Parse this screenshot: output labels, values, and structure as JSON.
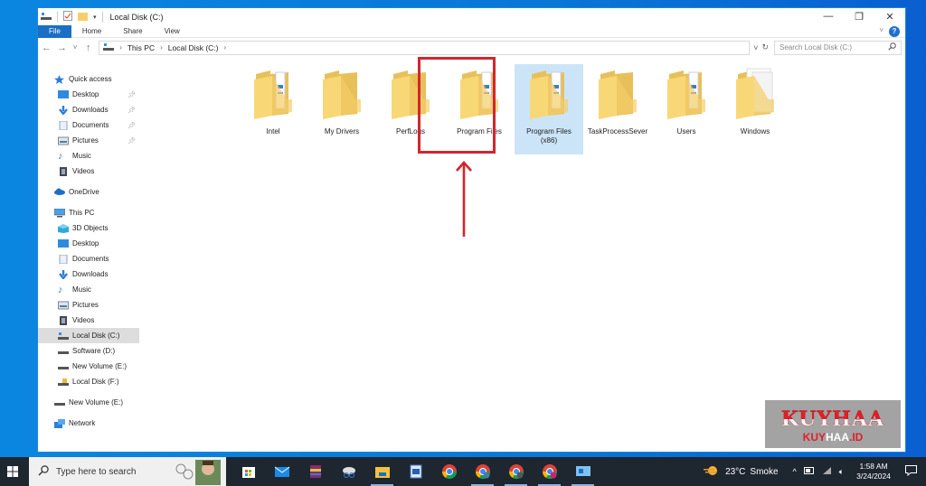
{
  "window": {
    "title": "Local Disk (C:)",
    "controls": {
      "minimize": "—",
      "maximize": "❐",
      "close": "✕"
    }
  },
  "ribbon": {
    "tabs": [
      {
        "label": "File",
        "active": true
      },
      {
        "label": "Home"
      },
      {
        "label": "Share"
      },
      {
        "label": "View"
      }
    ],
    "help_label": "?"
  },
  "address": {
    "back": "←",
    "forward": "→",
    "recent": "˅",
    "up": "↑",
    "breadcrumb": [
      "This PC",
      "Local Disk (C:)"
    ],
    "search_placeholder": "Search Local Disk (C:)"
  },
  "sidebar": {
    "quick_access": {
      "label": "Quick access",
      "items": [
        {
          "label": "Desktop",
          "icon": "desktop-icon",
          "pinned": true
        },
        {
          "label": "Downloads",
          "icon": "downloads-icon",
          "pinned": true
        },
        {
          "label": "Documents",
          "icon": "documents-icon",
          "pinned": true
        },
        {
          "label": "Pictures",
          "icon": "pictures-icon",
          "pinned": true
        },
        {
          "label": "Music",
          "icon": "music-icon",
          "pinned": false
        },
        {
          "label": "Videos",
          "icon": "videos-icon",
          "pinned": false
        }
      ]
    },
    "onedrive": {
      "label": "OneDrive"
    },
    "this_pc": {
      "label": "This PC",
      "items": [
        {
          "label": "3D Objects",
          "icon": "3d-objects-icon"
        },
        {
          "label": "Desktop",
          "icon": "desktop-icon"
        },
        {
          "label": "Documents",
          "icon": "documents-icon"
        },
        {
          "label": "Downloads",
          "icon": "downloads-icon"
        },
        {
          "label": "Music",
          "icon": "music-icon"
        },
        {
          "label": "Pictures",
          "icon": "pictures-icon"
        },
        {
          "label": "Videos",
          "icon": "videos-icon"
        },
        {
          "label": "Local Disk (C:)",
          "icon": "system-drive-icon",
          "selected": true
        },
        {
          "label": "Software (D:)",
          "icon": "drive-icon"
        },
        {
          "label": "New Volume (E:)",
          "icon": "drive-icon"
        },
        {
          "label": "Local Disk (F:)",
          "icon": "locked-drive-icon"
        }
      ]
    },
    "new_volume": {
      "label": "New Volume (E:)"
    },
    "network": {
      "label": "Network"
    }
  },
  "folders": [
    {
      "name": "Intel",
      "type": "docs"
    },
    {
      "name": "My Drivers",
      "type": "empty"
    },
    {
      "name": "PerfLogs",
      "type": "empty"
    },
    {
      "name": "Program Files",
      "type": "docs"
    },
    {
      "name": "Program Files (x86)",
      "line1": "Program Files",
      "line2": "(x86)",
      "type": "docs",
      "selected": true
    },
    {
      "name": "TaskProcessSever",
      "type": "empty"
    },
    {
      "name": "Users",
      "type": "docs"
    },
    {
      "name": "Windows",
      "type": "papers"
    }
  ],
  "annotation": {
    "color": "#d4252c",
    "target": "Program Files (x86)"
  },
  "watermark": {
    "big": "KUYHAA",
    "small": "KUYHAA.ID"
  },
  "taskbar": {
    "search_placeholder": "Type here to search",
    "apps": [
      "microsoft-store",
      "mail",
      "winrar",
      "snipping-tool",
      "file-explorer",
      "word-document",
      "chrome",
      "chrome-a",
      "chrome-b",
      "chrome-k",
      "remote-desktop"
    ],
    "weather": {
      "temp": "23°C",
      "condition": "Smoke"
    },
    "time": "1:58 AM",
    "date": "3/24/2024"
  }
}
